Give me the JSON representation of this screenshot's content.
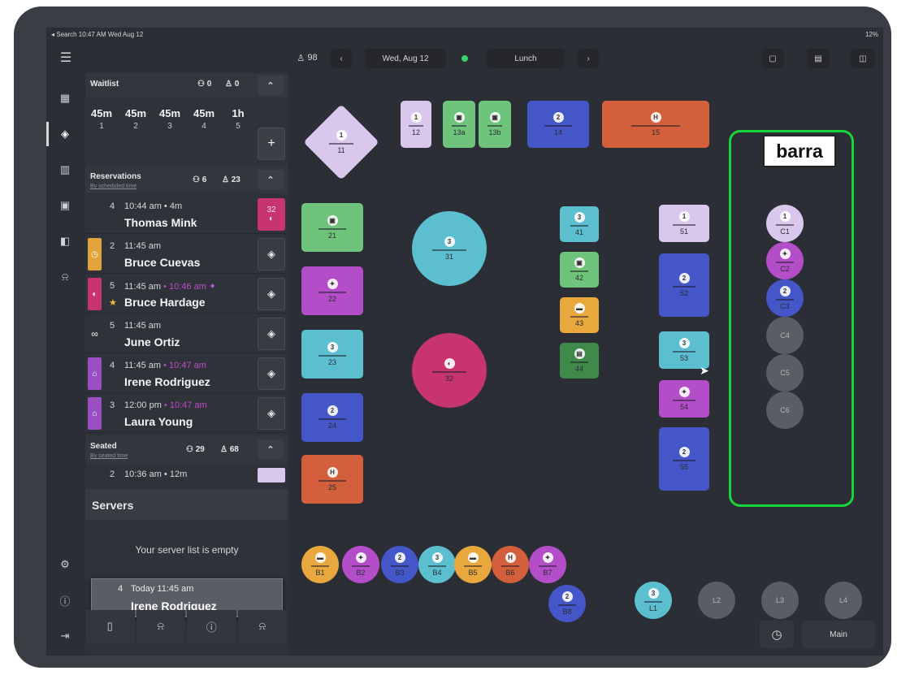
{
  "status": {
    "left": "◂ Search  10:47 AM  Wed Aug 12",
    "right": "12%"
  },
  "topbar": {
    "covers": "98",
    "date": "Wed, Aug 12",
    "shift": "Lunch"
  },
  "waitlist": {
    "title": "Waitlist",
    "parties": "0",
    "covers": "0",
    "cells": [
      {
        "time": "45m",
        "num": "1"
      },
      {
        "time": "45m",
        "num": "2"
      },
      {
        "time": "45m",
        "num": "3"
      },
      {
        "time": "45m",
        "num": "4"
      },
      {
        "time": "1h",
        "num": "5"
      }
    ]
  },
  "reservations": {
    "title": "Reservations",
    "sub": "By scheduled time",
    "parties": "6",
    "covers": "23",
    "rows": [
      {
        "party": "4",
        "time": "10:44 am • 4m",
        "late": "",
        "name": "Thomas Mink",
        "tag_color": "",
        "action": "32"
      },
      {
        "party": "2",
        "time": "11:45 am",
        "late": "",
        "name": "Bruce Cuevas",
        "tag_color": "#e2a43a",
        "action": "◈"
      },
      {
        "party": "5",
        "time": "11:45 am",
        "late": " • 10:46 am",
        "name": "Bruce Hardage",
        "tag_color": "#c8346e",
        "action": "◈"
      },
      {
        "party": "5",
        "time": "11:45 am",
        "late": "",
        "name": "June Ortiz",
        "tag_color": "",
        "action": "◈"
      },
      {
        "party": "4",
        "time": "11:45 am",
        "late": " • 10:47 am",
        "name": "Irene Rodriguez",
        "tag_color": "#9a4fc0",
        "action": "◈"
      },
      {
        "party": "3",
        "time": "12:00 pm",
        "late": " • 10:47 am",
        "name": "Laura Young",
        "tag_color": "#9a4fc0",
        "action": "◈"
      }
    ]
  },
  "seated": {
    "title": "Seated",
    "sub": "By seated time",
    "parties": "29",
    "covers": "68",
    "row_party": "2",
    "row_time": "10:36 am • 12m"
  },
  "servers": {
    "title": "Servers",
    "empty": "Your server list is empty"
  },
  "drag_card": {
    "party": "4",
    "time": "Today 11:45 am",
    "name": "Irene Rodriguez"
  },
  "annotation": {
    "label": "barra",
    "color": "#19d43a"
  },
  "floor_footer": {
    "room": "Main"
  },
  "tables": [
    {
      "id": "11",
      "n": "1"
    },
    {
      "id": "12",
      "n": "1"
    },
    {
      "id": "13a",
      "n": "▣"
    },
    {
      "id": "13b",
      "n": "▣"
    },
    {
      "id": "14",
      "n": "2"
    },
    {
      "id": "15",
      "n": "H"
    },
    {
      "id": "21",
      "n": "▣"
    },
    {
      "id": "22",
      "n": "✦"
    },
    {
      "id": "23",
      "n": "3"
    },
    {
      "id": "24",
      "n": "2"
    },
    {
      "id": "25",
      "n": "H"
    },
    {
      "id": "31",
      "n": "3"
    },
    {
      "id": "32",
      "n": "◐"
    },
    {
      "id": "41",
      "n": "3"
    },
    {
      "id": "42",
      "n": "▣"
    },
    {
      "id": "43",
      "n": "▬"
    },
    {
      "id": "44",
      "n": "▤"
    },
    {
      "id": "51",
      "n": "1"
    },
    {
      "id": "52",
      "n": "2"
    },
    {
      "id": "53",
      "n": "3"
    },
    {
      "id": "54",
      "n": "✦"
    },
    {
      "id": "55",
      "n": "2"
    },
    {
      "id": "C1",
      "n": "1"
    },
    {
      "id": "C2",
      "n": "✦"
    },
    {
      "id": "C3",
      "n": "2"
    },
    {
      "id": "C4",
      "n": ""
    },
    {
      "id": "C5",
      "n": ""
    },
    {
      "id": "C6",
      "n": ""
    },
    {
      "id": "B1",
      "n": "▬"
    },
    {
      "id": "B2",
      "n": "✦"
    },
    {
      "id": "B3",
      "n": "2"
    },
    {
      "id": "B4",
      "n": "3"
    },
    {
      "id": "B5",
      "n": "▬"
    },
    {
      "id": "B6",
      "n": "H"
    },
    {
      "id": "B7",
      "n": "✦"
    },
    {
      "id": "B8",
      "n": "2"
    },
    {
      "id": "L1",
      "n": "3"
    },
    {
      "id": "L2",
      "n": ""
    },
    {
      "id": "L3",
      "n": ""
    },
    {
      "id": "L4",
      "n": ""
    }
  ]
}
